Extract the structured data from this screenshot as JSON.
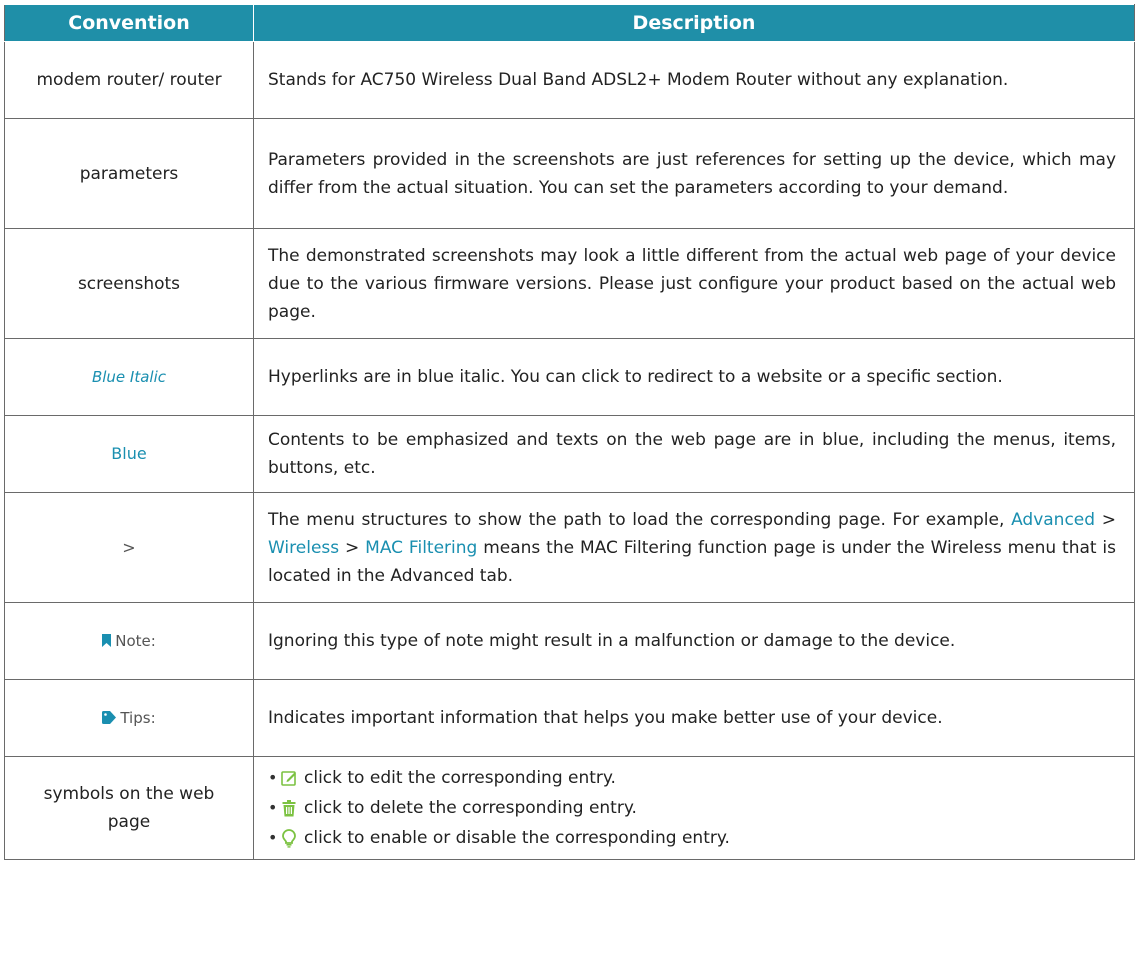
{
  "table": {
    "headers": {
      "convention": "Convention",
      "description": "Description"
    },
    "rows": [
      {
        "convention": "modem router/ router",
        "description": "Stands for AC750 Wireless Dual Band ADSL2+ Modem Router without any explanation."
      },
      {
        "convention": "parameters",
        "description": "Parameters provided in the screenshots are just references for setting up the device, which may differ from the actual situation. You can set the parameters according to your demand."
      },
      {
        "convention": "screenshots",
        "description": "The demonstrated screenshots may look a little different from the actual web page of your device due to the various firmware versions. Please just configure your product based on the actual web page."
      },
      {
        "convention": "Blue Italic",
        "description": "Hyperlinks are in blue italic. You can click to redirect to a website or a specific section."
      },
      {
        "convention": "Blue",
        "description": "Contents to be emphasized and texts on the web page are in blue, including the menus, items, buttons, etc."
      },
      {
        "convention": ">",
        "description_before": "The menu structures to show the path to load the corresponding page. For example,",
        "path_advanced": "Advanced",
        "path_sep_1": ">",
        "path_wireless": "Wireless",
        "path_sep_2": ">",
        "path_mac_filtering": "MAC Filtering",
        "description_after": "means the MAC Filtering function page is under the Wireless menu that is located in the Advanced tab."
      },
      {
        "convention": "Note:",
        "description": "Ignoring this type of note might result in a malfunction or damage to the device."
      },
      {
        "convention": "Tips:",
        "description": "Indicates important information that helps you make better use of your device."
      },
      {
        "convention": "symbols on the web page",
        "bullets": [
          "click to edit the corresponding entry.",
          "click to delete the corresponding entry.",
          "click to enable or disable the corresponding entry."
        ]
      }
    ]
  },
  "colors": {
    "header_bg": "#1f8fa8",
    "accent_blue": "#1a8fb0",
    "edit_icon": "#7cc242",
    "delete_icon": "#7cc242",
    "bulb_icon": "#7cc242"
  },
  "icons": {
    "note": "bookmark-icon",
    "tips": "tag-icon",
    "edit": "edit-icon",
    "delete": "trash-icon",
    "enable": "bulb-icon"
  }
}
